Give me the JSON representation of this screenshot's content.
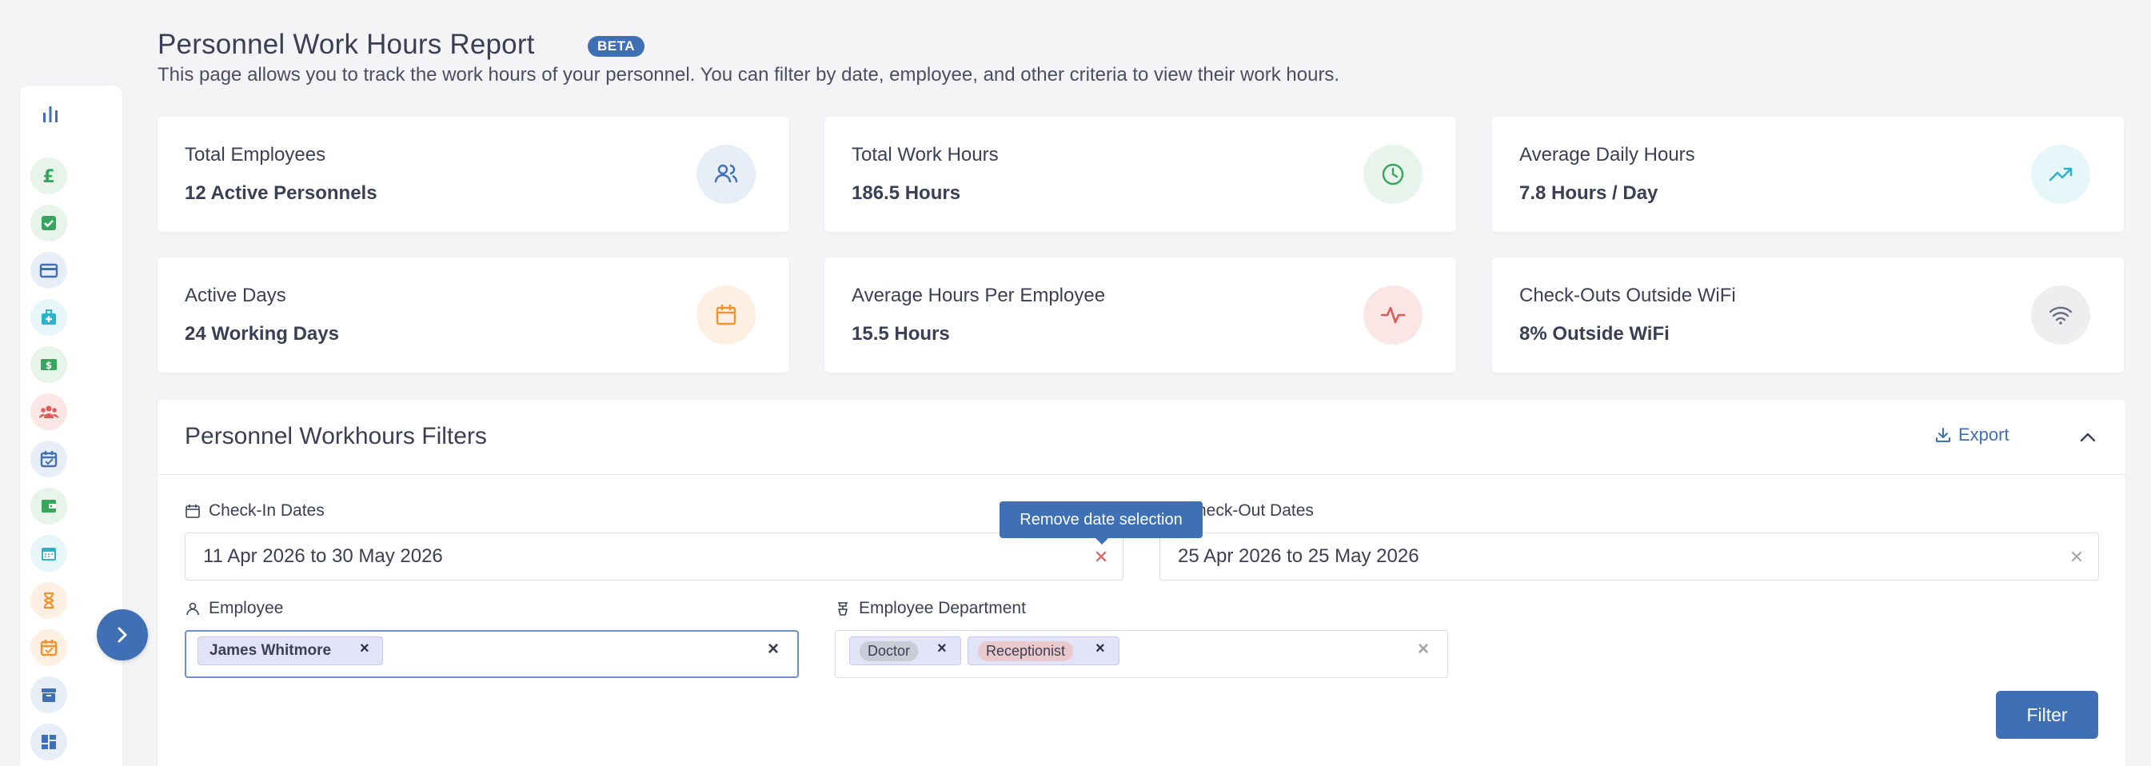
{
  "header": {
    "title": "Personnel Work Hours Report",
    "badge": "BETA",
    "description": "This page allows you to track the work hours of your personnel. You can filter by date, employee, and other criteria to view their work hours."
  },
  "sidebar": {
    "top_icon": "bar-chart-icon",
    "items": [
      {
        "icon": "pound-icon",
        "color": "#37a55b"
      },
      {
        "icon": "checklist-icon",
        "color": "#37a55b"
      },
      {
        "icon": "credit-card-icon",
        "color": "#3f6fb5"
      },
      {
        "icon": "medical-bag-icon",
        "color": "#2bb3c8"
      },
      {
        "icon": "cash-icon",
        "color": "#37a55b"
      },
      {
        "icon": "team-icon",
        "color": "#e05a5a"
      },
      {
        "icon": "calendar-check-icon",
        "color": "#3f6fb5"
      },
      {
        "icon": "wallet-icon",
        "color": "#37a55b"
      },
      {
        "icon": "calendar-icon",
        "color": "#2bb3c8"
      },
      {
        "icon": "hourglass-icon",
        "color": "#f0922e"
      },
      {
        "icon": "calendar-clock-icon",
        "color": "#f0922e"
      },
      {
        "icon": "archive-icon",
        "color": "#3f6fb5"
      },
      {
        "icon": "dashboard-icon",
        "color": "#3f6fb5"
      }
    ]
  },
  "stats": [
    {
      "label": "Total Employees",
      "value": "12 Active Personnels",
      "icon": "users-icon",
      "color": "#3f6fb5",
      "bg": "#e8eef8"
    },
    {
      "label": "Total Work Hours",
      "value": "186.5 Hours",
      "icon": "clock-icon",
      "color": "#37a55b",
      "bg": "#e8f5ec"
    },
    {
      "label": "Average Daily Hours",
      "value": "7.8 Hours / Day",
      "icon": "trending-up-icon",
      "color": "#2bb3c8",
      "bg": "#e6f6f9"
    },
    {
      "label": "Active Days",
      "value": "24 Working Days",
      "icon": "calendar-icon",
      "color": "#f0922e",
      "bg": "#fdf0e2"
    },
    {
      "label": "Average Hours Per Employee",
      "value": "15.5 Hours",
      "icon": "activity-icon",
      "color": "#e05a5a",
      "bg": "#fbe6e6"
    },
    {
      "label": "Check-Outs Outside WiFi",
      "value": "8% Outside WiFi",
      "icon": "wifi-icon",
      "color": "#6b6f80",
      "bg": "#eeeef0"
    }
  ],
  "filters": {
    "title": "Personnel Workhours Filters",
    "export_label": "Export",
    "checkin_label": "Check-In Dates",
    "checkin_value": "11 Apr 2026 to 30 May 2026",
    "checkout_label": "heck-Out Dates",
    "checkout_value": "25 Apr 2026 to 25 May 2026",
    "tooltip": "Remove date selection",
    "employee_label": "Employee",
    "employee_chip": "James Whitmore",
    "department_label": "Employee Department",
    "department_chips": [
      {
        "label": "Doctor",
        "bg": "#c7ccd6"
      },
      {
        "label": "Receptionist",
        "bg": "#e9c9cc"
      }
    ],
    "filter_button": "Filter"
  }
}
